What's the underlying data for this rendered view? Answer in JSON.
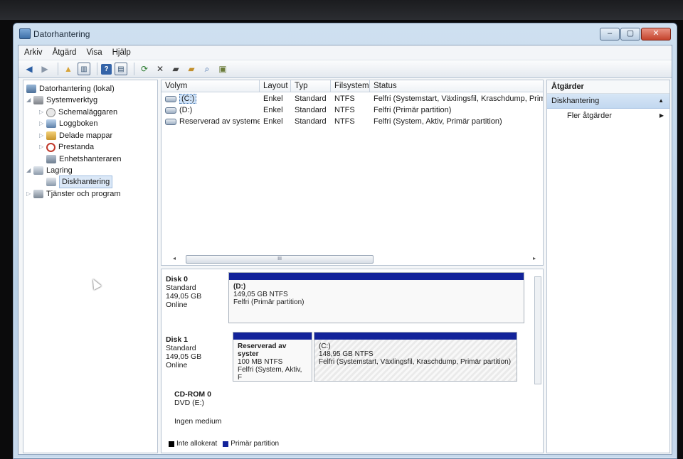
{
  "window": {
    "title": "Datorhantering",
    "buttons": [
      "–",
      "▢",
      "✕"
    ]
  },
  "menu": [
    "Arkiv",
    "Åtgärd",
    "Visa",
    "Hjälp"
  ],
  "toolbar": {
    "icons": [
      "back-icon",
      "forward-icon",
      "up-icon",
      "show-tree-icon",
      "help-icon",
      "properties-icon",
      "refresh-icon",
      "delete-icon",
      "settings-icon",
      "open-folder-icon",
      "search-icon",
      "disk-icon"
    ]
  },
  "tree": {
    "root": "Datorhantering (lokal)",
    "system_tools": "Systemverktyg",
    "scheduler": "Schemaläggaren",
    "eventlog": "Loggboken",
    "shared": "Delade mappar",
    "perf": "Prestanda",
    "devmgr": "Enhetshanteraren",
    "storage": "Lagring",
    "diskmgmt": "Diskhantering",
    "services": "Tjänster och program"
  },
  "volumes": {
    "headers": [
      "Volym",
      "Layout",
      "Typ",
      "Filsystem",
      "Status"
    ],
    "rows": [
      {
        "name": "(C:)",
        "layout": "Enkel",
        "type": "Standard",
        "fs": "NTFS",
        "status": "Felfri (Systemstart, Växlingsfil, Kraschdump, Primär p"
      },
      {
        "name": "(D:)",
        "layout": "Enkel",
        "type": "Standard",
        "fs": "NTFS",
        "status": "Felfri (Primär partition)"
      },
      {
        "name": "Reserverad av systemet",
        "layout": "Enkel",
        "type": "Standard",
        "fs": "NTFS",
        "status": "Felfri (System, Aktiv, Primär partition)"
      }
    ],
    "scroll_thumb": "III"
  },
  "disks": {
    "disk0": {
      "name": "Disk 0",
      "type": "Standard",
      "size": "149,05 GB",
      "state": "Online",
      "part": {
        "name": "(D:)",
        "size": "149,05 GB NTFS",
        "status": "Felfri (Primär partition)"
      }
    },
    "disk1": {
      "name": "Disk 1",
      "type": "Standard",
      "size": "149,05 GB",
      "state": "Online",
      "part1": {
        "name": "Reserverad av syster",
        "size": "100 MB NTFS",
        "status": "Felfri (System, Aktiv, F"
      },
      "part2": {
        "name": "(C:)",
        "size": "148,95 GB NTFS",
        "status": "Felfri (Systemstart, Växlingsfil, Kraschdump, Primär partition)"
      }
    },
    "cdrom": {
      "name": "CD-ROM 0",
      "type": "DVD (E:)",
      "state": "Ingen medium"
    },
    "legend": {
      "unallocated": "Inte allokerat",
      "primary": "Primär partition"
    },
    "colors": {
      "unallocated": "#000000",
      "primary": "#13239a"
    }
  },
  "actions": {
    "header": "Åtgärder",
    "section": "Diskhantering",
    "more": "Fler åtgärder"
  }
}
